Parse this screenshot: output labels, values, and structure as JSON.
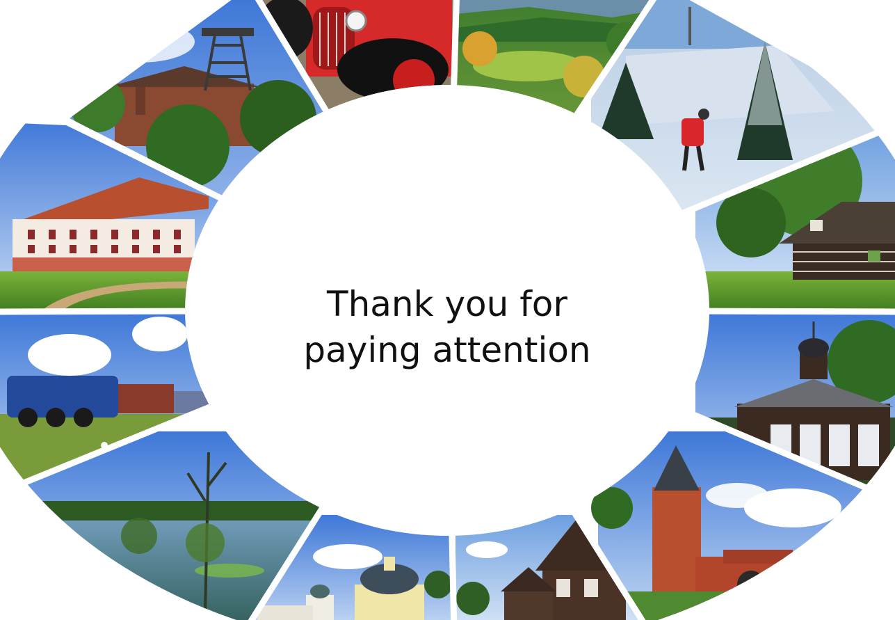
{
  "slide": {
    "message_line1": "Thank you for",
    "message_line2": "paying attention",
    "background_color": "#ffffff",
    "text_color": "#111111"
  },
  "photos": [
    {
      "name": "photo-mine-tower",
      "subject": "mine headframe tower with building"
    },
    {
      "name": "photo-vintage-car",
      "subject": "red vintage car"
    },
    {
      "name": "photo-green-hills",
      "subject": "green hilly countryside"
    },
    {
      "name": "photo-winter-skier",
      "subject": "cross-country skier in snowy forest"
    },
    {
      "name": "photo-wooden-cottage",
      "subject": "timber cottage among trees"
    },
    {
      "name": "photo-wooden-pavilion",
      "subject": "wooden pavilion with towers"
    },
    {
      "name": "photo-red-castle",
      "subject": "red brick castle tower"
    },
    {
      "name": "photo-timber-houses",
      "subject": "timber houses in village"
    },
    {
      "name": "photo-baroque-church",
      "subject": "baroque church under blue sky"
    },
    {
      "name": "photo-wetland-lake",
      "subject": "wetland lake with trees"
    },
    {
      "name": "photo-steam-train",
      "subject": "blue steam train in meadow"
    },
    {
      "name": "photo-chateau",
      "subject": "long chateau with red roof"
    }
  ]
}
